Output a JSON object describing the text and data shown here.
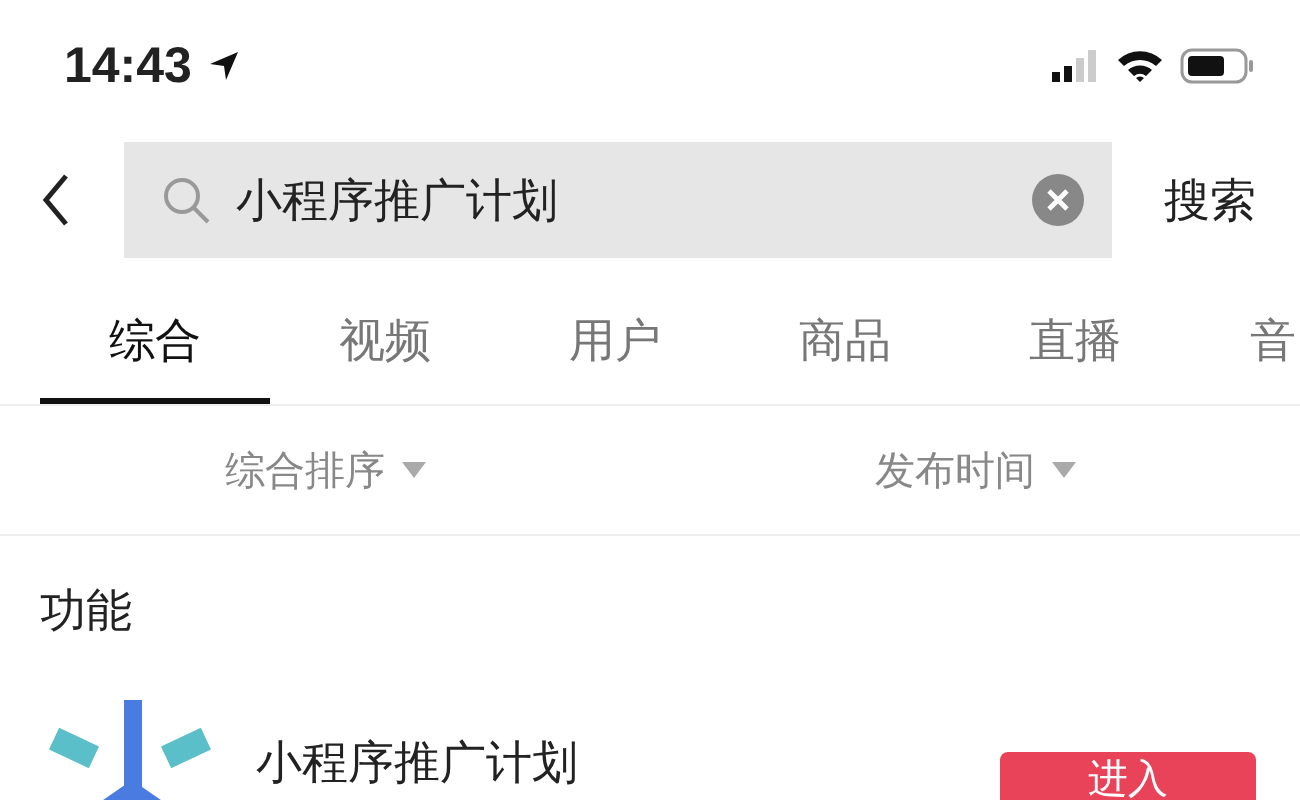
{
  "status_bar": {
    "time": "14:43"
  },
  "search": {
    "value": "小程序推广计划",
    "button": "搜索"
  },
  "tabs": [
    {
      "label": "综合",
      "selected": true
    },
    {
      "label": "视频",
      "selected": false
    },
    {
      "label": "用户",
      "selected": false
    },
    {
      "label": "商品",
      "selected": false
    },
    {
      "label": "直播",
      "selected": false
    },
    {
      "label": "音",
      "selected": false
    }
  ],
  "filters": [
    "综合排序",
    "发布时间"
  ],
  "section": {
    "title": "功能"
  },
  "result": {
    "title": "小程序推广计划",
    "button": "进入"
  }
}
